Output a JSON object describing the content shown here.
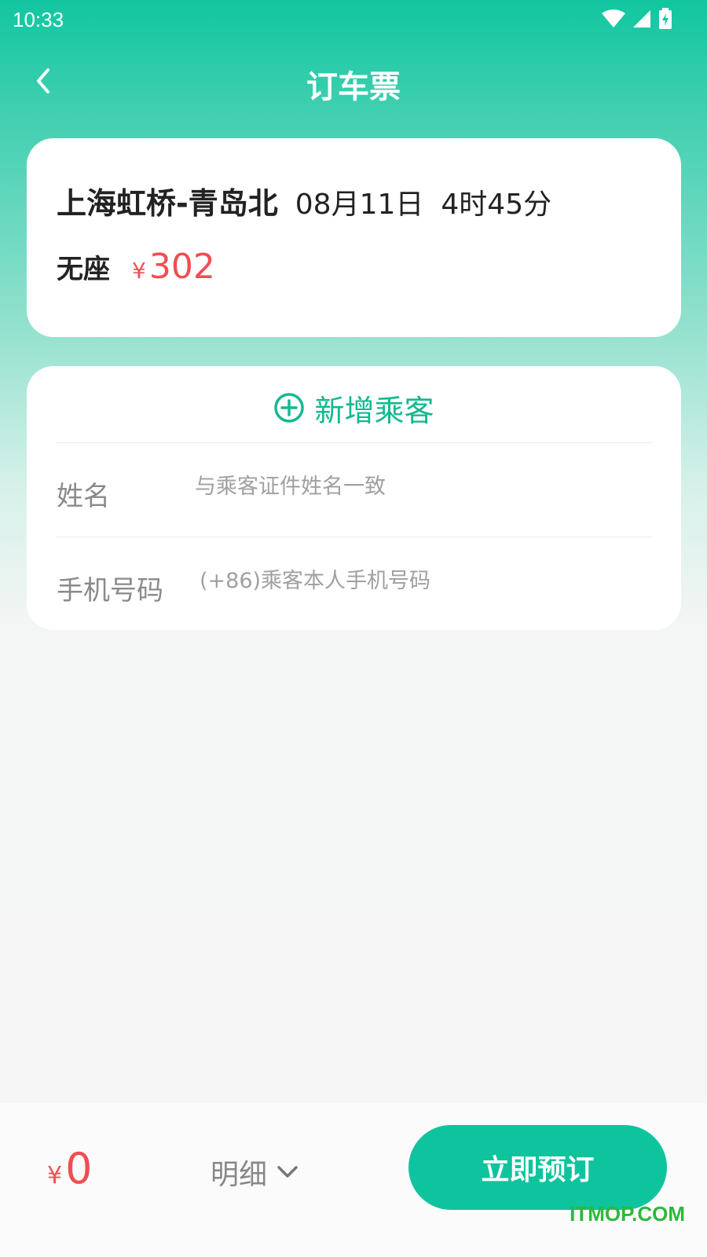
{
  "status_bar": {
    "time": "10:33"
  },
  "header": {
    "title": "订车票"
  },
  "ticket": {
    "route": "上海虹桥-青岛北",
    "date": "08月11日",
    "duration": "4时45分",
    "seat": "无座",
    "currency": "¥",
    "price": "302"
  },
  "passenger": {
    "add_label": "新增乘客",
    "name_label": "姓名",
    "name_placeholder": "与乘客证件姓名一致",
    "phone_label": "手机号码",
    "phone_placeholder": "(+86)乘客本人手机号码"
  },
  "footer": {
    "currency": "¥",
    "total": "0",
    "detail_label": "明细",
    "book_label": "立即预订"
  },
  "watermark": "ITMOP.COM",
  "colors": {
    "accent": "#0ec49e",
    "price": "#f04e52"
  }
}
